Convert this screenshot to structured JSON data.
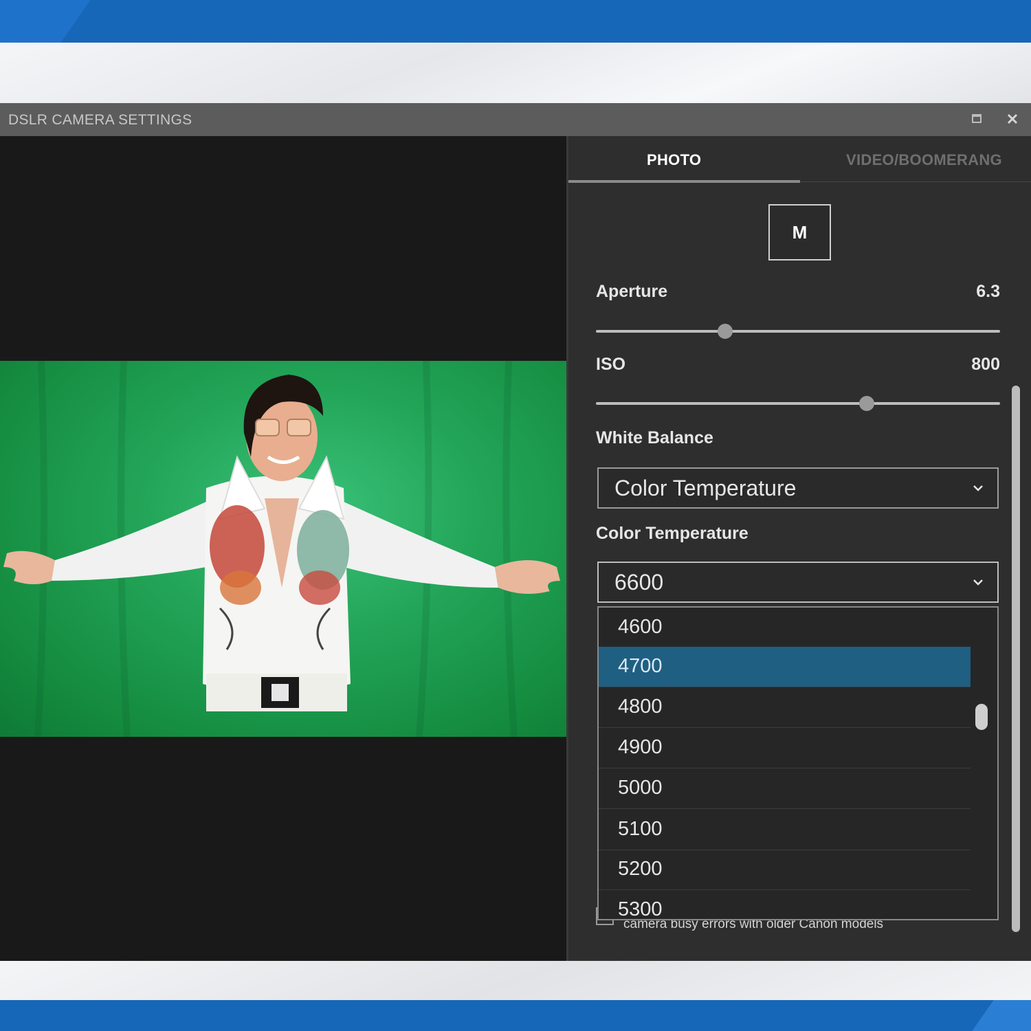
{
  "window": {
    "title": "DSLR CAMERA SETTINGS",
    "restore_icon": "restore-icon",
    "close_icon": "close-icon"
  },
  "tabs": [
    {
      "label": "PHOTO",
      "active": true
    },
    {
      "label": "VIDEO/BOOMERANG",
      "active": false
    }
  ],
  "mode": {
    "label": "M"
  },
  "aperture": {
    "label": "Aperture",
    "value": "6.3",
    "slider_position": 0.32
  },
  "iso": {
    "label": "ISO",
    "value": "800",
    "slider_position": 0.67
  },
  "white_balance": {
    "label": "White Balance",
    "selected": "Color Temperature"
  },
  "color_temperature": {
    "label": "Color Temperature",
    "selected": "6600",
    "options": [
      "4600",
      "4700",
      "4800",
      "4900",
      "5000",
      "5100",
      "5200",
      "5300"
    ],
    "highlighted": "4700"
  },
  "footer_note": "camera busy errors with older Canon models",
  "colors": {
    "accent_blue": "#1767b8",
    "selection": "#1f5f82",
    "chroma_green": "#22a457"
  }
}
